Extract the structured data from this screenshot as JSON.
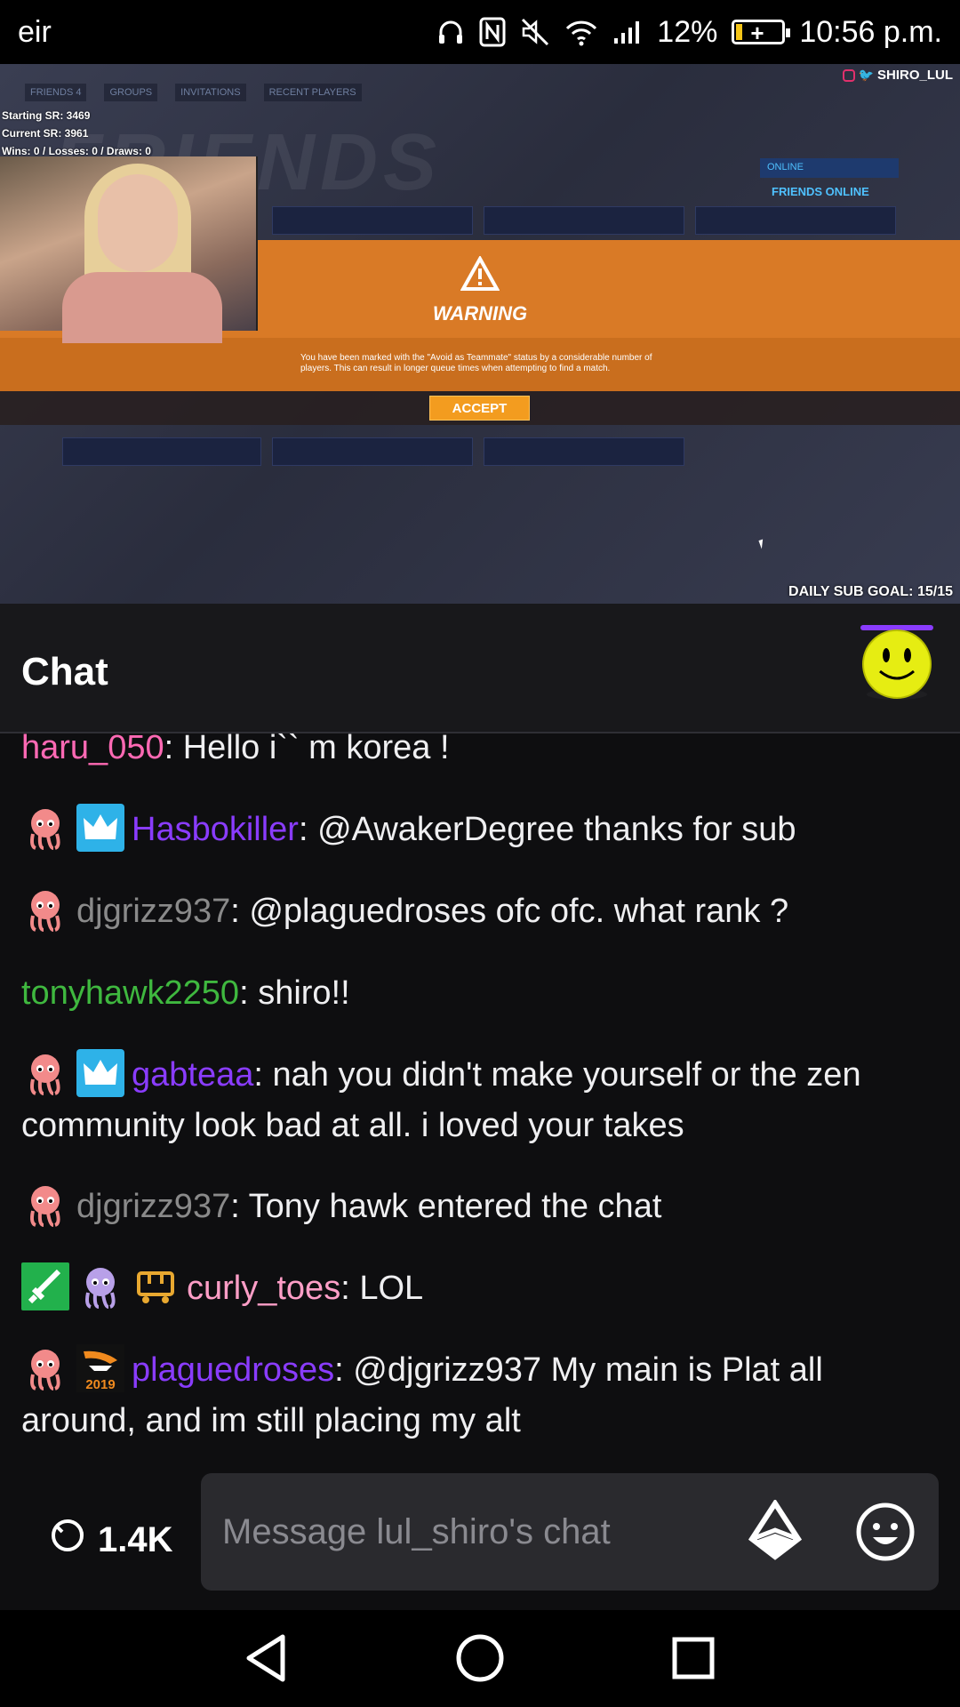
{
  "statusbar": {
    "carrier": "eir",
    "battery": "12%",
    "battery_level": 0.12,
    "time": "10:56 p.m."
  },
  "video": {
    "overlay_handle": "SHIRO_LUL",
    "stats": {
      "starting_sr": "Starting SR: 3469",
      "current_sr": "Current SR: 3961",
      "record": "Wins: 0 / Losses: 0 / Draws: 0"
    },
    "game": {
      "nav_tabs": [
        "FRIENDS 4",
        "GROUPS",
        "INVITATIONS",
        "RECENT PLAYERS"
      ],
      "bg_title": "FRIENDS",
      "status_dropdown": "ONLINE",
      "friends_online": "FRIENDS ONLINE",
      "warning_title": "WARNING",
      "warning_text": "You have been marked with the \"Avoid as Teammate\" status by a considerable number of players. This can result in longer queue times when attempting to find a match.",
      "accept_label": "ACCEPT"
    },
    "sub_goal": "DAILY SUB GOAL: 15/15"
  },
  "chat": {
    "title": "Chat",
    "messages": [
      {
        "user": "haru_050",
        "color": "#ff69b4",
        "text": ": Hello i`` m korea !"
      },
      {
        "user": "Hasbokiller",
        "color": "#8a3cff",
        "text": ": @AwakerDegree thanks for sub"
      },
      {
        "user": "djgrizz937",
        "color": "#8a8a8a",
        "text": ": @plaguedroses ofc ofc. what rank ?"
      },
      {
        "user": "tonyhawk2250",
        "color": "#3fb83f",
        "text": ": shiro!!"
      },
      {
        "user": "gabteaa",
        "color": "#8a3cff",
        "text": ": nah you didn't make yourself or the zen community look bad at all. i loved your takes"
      },
      {
        "user": "djgrizz937",
        "color": "#8a8a8a",
        "text": ": Tony hawk entered the chat"
      },
      {
        "user": "curly_toes",
        "color": "#ff9ec7",
        "text": ": LOL"
      },
      {
        "user": "plaguedroses",
        "color": "#8a3cff",
        "text": ": @djgrizz937 My main is Plat all around, and im still placing my alt"
      }
    ],
    "badge_year": "2019"
  },
  "input": {
    "viewer_count": "1.4K",
    "placeholder": "Message lul_shiro's chat"
  }
}
